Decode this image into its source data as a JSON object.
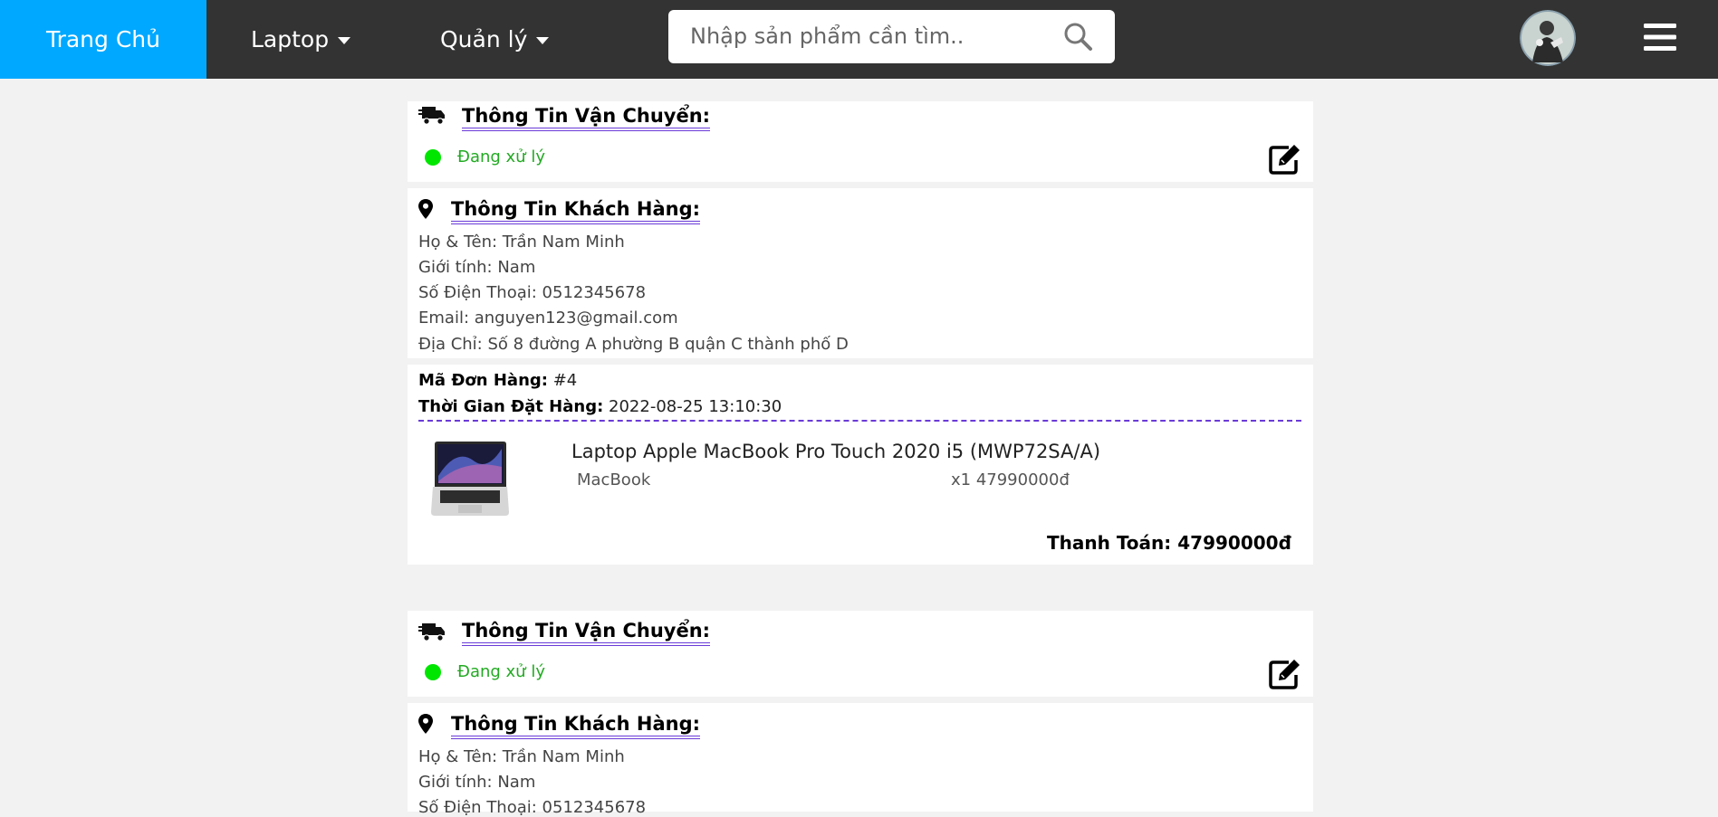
{
  "nav": {
    "home": "Trang Chủ",
    "laptop": "Laptop",
    "manage": "Quản lý",
    "search_placeholder": "Nhập sản phẩm cần tìm.."
  },
  "orders": [
    {
      "shipping_title": "Thông Tin Vận Chuyển:",
      "status": "Đang xử lý",
      "customer_title": "Thông Tin Khách Hàng:",
      "name_line": "Họ & Tên: Trần Nam Minh",
      "gender_line": "Giới tính: Nam",
      "phone_line": "Số Điện Thoại: 0512345678",
      "email_line": "Email: anguyen123@gmail.com",
      "address_line": "Địa Chỉ: Số 8 đường A phường B quận C thành phố D",
      "order_id_label": "Mã Đơn Hàng:",
      "order_id": "#4",
      "order_time_label": "Thời Gian Đặt Hàng:",
      "order_time": "2022-08-25 13:10:30",
      "product_name": "Laptop Apple MacBook Pro Touch 2020 i5 (MWP72SA/A)",
      "product_brand": "MacBook",
      "product_qty_price": "x1 47990000đ",
      "total_label": "Thanh Toán: 47990000đ"
    },
    {
      "shipping_title": "Thông Tin Vận Chuyển:",
      "status": "Đang xử lý",
      "customer_title": "Thông Tin Khách Hàng:",
      "name_line": "Họ & Tên: Trần Nam Minh",
      "gender_line": "Giới tính: Nam",
      "phone_line": "Số Điện Thoại: 0512345678"
    }
  ],
  "colors": {
    "accent": "#00a8ff",
    "navbar": "#333333",
    "status": "#00e600",
    "underline": "#6a3ad8"
  },
  "icons": [
    "search-icon",
    "user-avatar",
    "hamburger-menu-icon",
    "truck-icon",
    "edit-icon",
    "map-marker-icon",
    "laptop-image"
  ]
}
